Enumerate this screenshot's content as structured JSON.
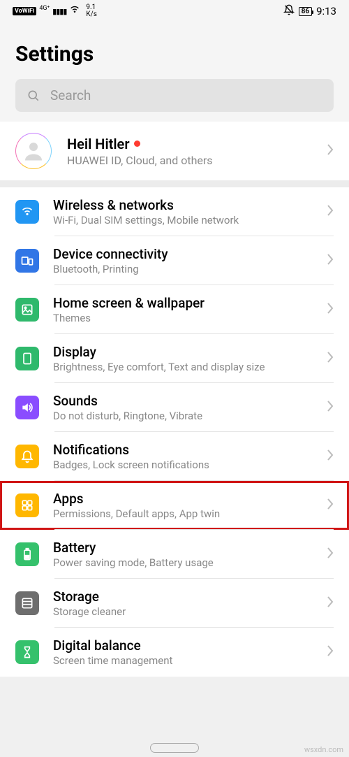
{
  "status": {
    "vowifi": "VoWiFi",
    "net_gen": "4G⁺",
    "speed_top": "9.1",
    "speed_bot": "K/s",
    "battery": "86",
    "time": "9:13"
  },
  "title": "Settings",
  "search": {
    "placeholder": "Search"
  },
  "account": {
    "name": "Heil Hitler",
    "sub": "HUAWEI ID, Cloud, and others"
  },
  "items": [
    {
      "title": "Wireless & networks",
      "sub": "Wi-Fi, Dual SIM settings, Mobile network",
      "icon": "wifi",
      "color": "bg-blue"
    },
    {
      "title": "Device connectivity",
      "sub": "Bluetooth, Printing",
      "icon": "devices",
      "color": "bg-blue2"
    },
    {
      "title": "Home screen & wallpaper",
      "sub": "Themes",
      "icon": "image",
      "color": "bg-green"
    },
    {
      "title": "Display",
      "sub": "Brightness, Eye comfort, Text and display size",
      "icon": "display",
      "color": "bg-green"
    },
    {
      "title": "Sounds",
      "sub": "Do not disturb, Ringtone, Vibrate",
      "icon": "sound",
      "color": "bg-purple"
    },
    {
      "title": "Notifications",
      "sub": "Badges, Lock screen notifications",
      "icon": "bell",
      "color": "bg-yellow"
    },
    {
      "title": "Apps",
      "sub": "Permissions, Default apps, App twin",
      "icon": "apps",
      "color": "bg-orange",
      "highlight": true
    },
    {
      "title": "Battery",
      "sub": "Power saving mode, Battery usage",
      "icon": "battery",
      "color": "bg-green2"
    },
    {
      "title": "Storage",
      "sub": "Storage cleaner",
      "icon": "storage",
      "color": "bg-gray"
    },
    {
      "title": "Digital balance",
      "sub": "Screen time management",
      "icon": "hourglass",
      "color": "bg-green2"
    }
  ],
  "watermark": "wsxdn.com"
}
